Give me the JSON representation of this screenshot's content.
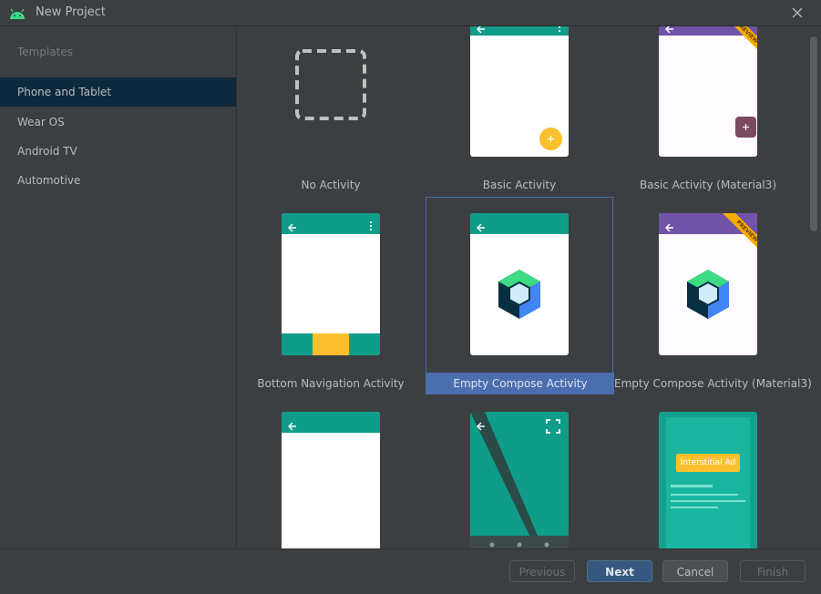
{
  "window": {
    "title": "New Project"
  },
  "sidebar": {
    "header": "Templates",
    "items": [
      {
        "label": "Phone and Tablet",
        "selected": true
      },
      {
        "label": "Wear OS",
        "selected": false
      },
      {
        "label": "Android TV",
        "selected": false
      },
      {
        "label": "Automotive",
        "selected": false
      }
    ]
  },
  "templates": [
    {
      "label": "No Activity"
    },
    {
      "label": "Basic Activity"
    },
    {
      "label": "Basic Activity (Material3)",
      "badge": "PREVIEW"
    },
    {
      "label": "Bottom Navigation Activity"
    },
    {
      "label": "Empty Compose Activity",
      "selected": true
    },
    {
      "label": "Empty Compose Activity (Material3)",
      "badge": "PREVIEW"
    },
    {
      "label": ""
    },
    {
      "label": ""
    },
    {
      "label": "",
      "ad_text": "Interstitial Ad"
    }
  ],
  "footer": {
    "previous_label": "Previous",
    "next_label": "Next",
    "cancel_label": "Cancel",
    "finish_label": "Finish"
  },
  "colors": {
    "teal": "#0f9d8a",
    "purple": "#6f54a7",
    "fab_yellow": "#fbc02d",
    "fab_purple": "#7b4a5e",
    "selection": "#4b6eaf"
  }
}
